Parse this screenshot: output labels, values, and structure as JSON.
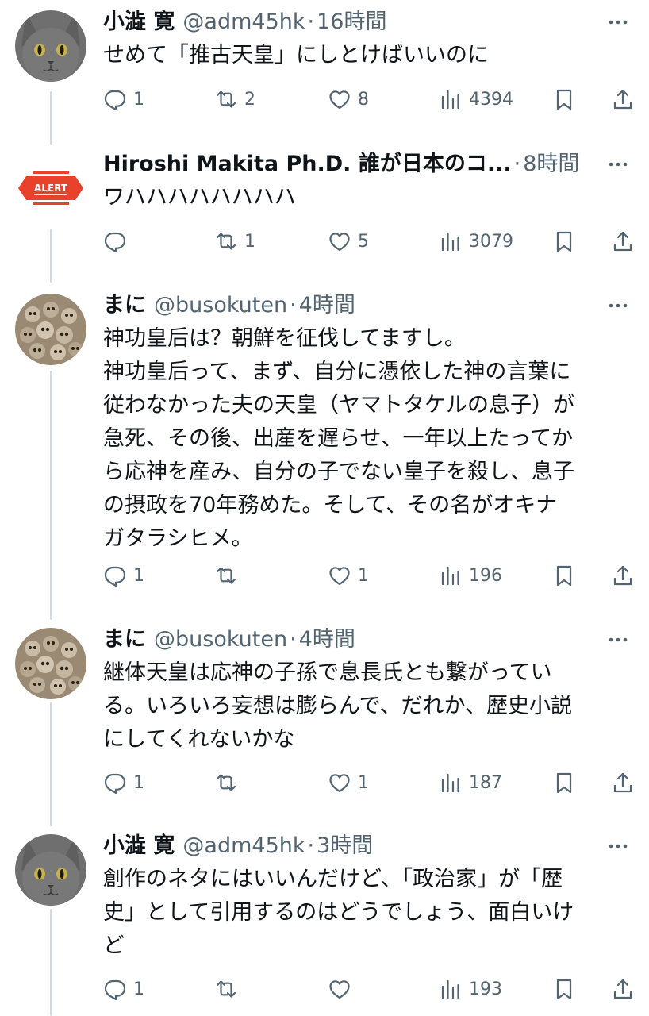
{
  "tweets": [
    {
      "name": "小澁 寛",
      "handle": "@adm45hk",
      "separator": "·",
      "time": "16時間",
      "avatar_icon": "gray-cat-avatar",
      "text": "せめて「推古天皇」にしとけばいいのに",
      "reply_count": "1",
      "retweet_count": "2",
      "like_count": "8",
      "view_count": "4394"
    },
    {
      "name": "Hiroshi Makita Ph.D. 誰が日本のコ...",
      "handle": "",
      "separator": "·",
      "time": "8時間",
      "avatar_icon": "alert-logo-avatar",
      "avatar_logo_text": "ALERT",
      "text": "ワハハハハハハハハ",
      "reply_count": "",
      "retweet_count": "1",
      "like_count": "5",
      "view_count": "3079"
    },
    {
      "name": "まに",
      "handle": "@busokuten",
      "separator": "·",
      "time": "4時間",
      "avatar_icon": "owls-photo-avatar",
      "text": "神功皇后は？朝鮮を征伐してますし。\n神功皇后って、まず、自分に憑依した神の言葉に\n従わなかった夫の天皇（ヤマトタケルの息子）が\n急死、その後、出産を遅らせ、一年以上たってか\nら応神を産み、自分の子でない皇子を殺し、息子\nの摂政を70年務めた。そして、その名がオキナ\nガタラシヒメ。",
      "reply_count": "1",
      "retweet_count": "",
      "like_count": "1",
      "view_count": "196"
    },
    {
      "name": "まに",
      "handle": "@busokuten",
      "separator": "·",
      "time": "4時間",
      "avatar_icon": "owls-photo-avatar",
      "text": "継体天皇は応神の子孫で息長氏とも繋がってい\nる。いろいろ妄想は膨らんで、だれか、歴史小説\nにしてくれないかな",
      "reply_count": "1",
      "retweet_count": "",
      "like_count": "1",
      "view_count": "187"
    },
    {
      "name": "小澁 寛",
      "handle": "@adm45hk",
      "separator": "·",
      "time": "3時間",
      "avatar_icon": "gray-cat-avatar",
      "text": "創作のネタにはいいんだけど、「政治家」が「歴\n史」として引用するのはどうでしょう、面白いけ\nど",
      "reply_count": "1",
      "retweet_count": "",
      "like_count": "",
      "view_count": "193"
    }
  ],
  "icons": {
    "reply": "reply-icon",
    "retweet": "retweet-icon",
    "like": "heart-icon",
    "views": "views-chart-icon",
    "bookmark": "bookmark-icon",
    "share": "share-icon",
    "more": "more-options-icon"
  },
  "colors": {
    "text": "#0f1419",
    "secondary": "#536471",
    "thread_line": "#cfd9de",
    "alert_red": "#e8412c"
  }
}
